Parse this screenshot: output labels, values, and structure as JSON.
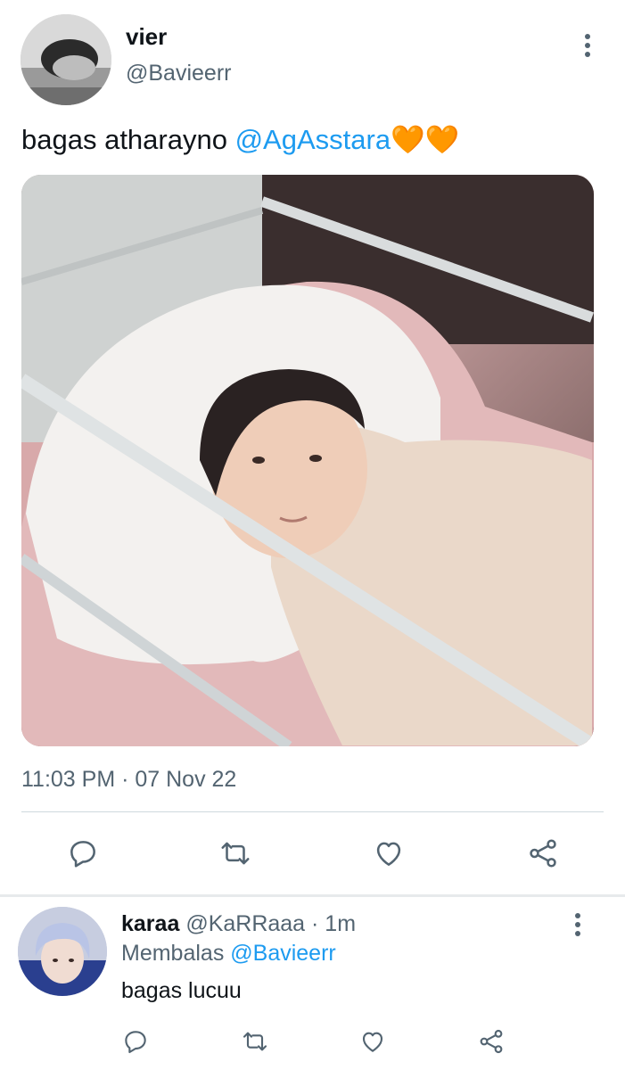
{
  "tweet": {
    "author_name": "vier",
    "author_handle": "@Bavieerr",
    "text": "bagas atharayno ",
    "mention": "@AgAsstara",
    "emoji": "🧡🧡",
    "timestamp": "11:03 PM · 07 Nov 22",
    "actions": [
      "reply-icon",
      "retweet-icon",
      "like-icon",
      "share-icon"
    ]
  },
  "reply": {
    "author_name": "karaa",
    "author_handle": "@KaRRaaa",
    "time": " · 1m",
    "replying_label": "Membalas ",
    "replying_to": "@Bavieerr",
    "text": "bagas lucuu"
  },
  "colors": {
    "accent": "#1d9bf0",
    "secondary_text": "#536471",
    "heart_emoji": "#f5a623"
  }
}
